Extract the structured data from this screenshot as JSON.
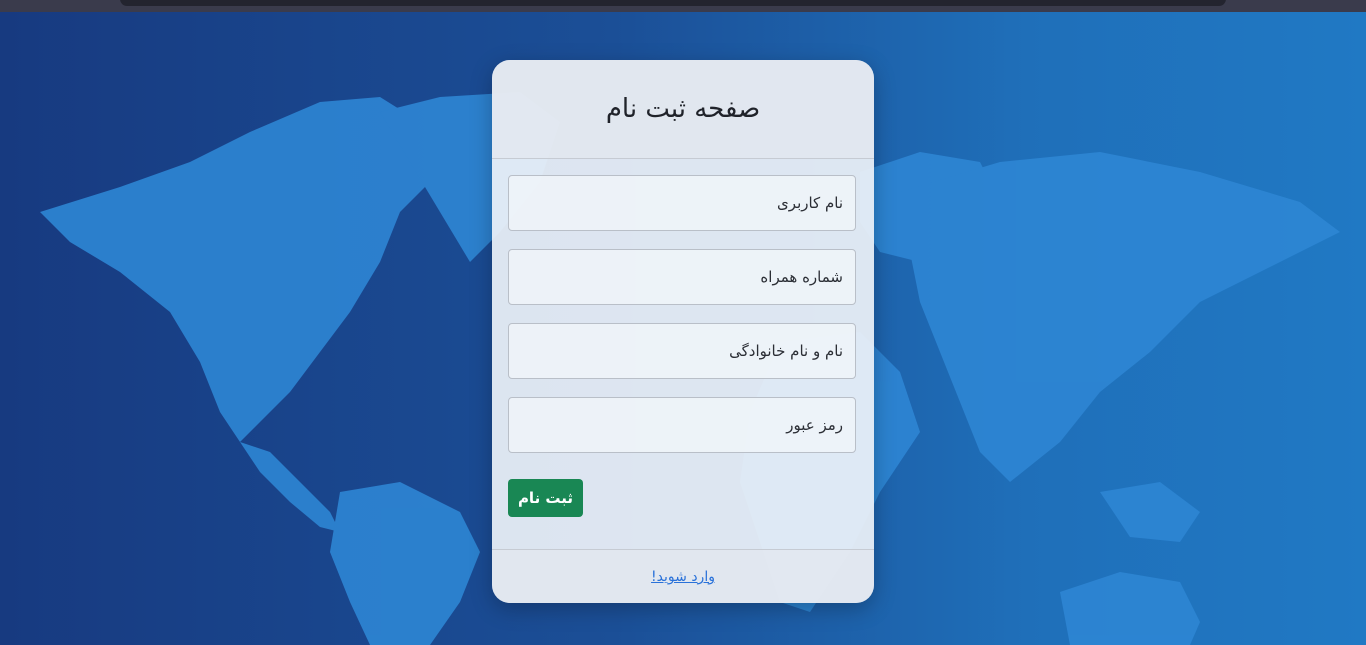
{
  "page": {
    "background_color": "#1b4f97",
    "map_color": "#2e86d4"
  },
  "card": {
    "title": "صفحه ثبت نام"
  },
  "form": {
    "username_placeholder": "نام کاربری",
    "phone_placeholder": "شماره همراه",
    "fullname_placeholder": "نام و نام خانوادگی",
    "password_placeholder": "رمز عبور",
    "submit_label": "ثبت نام",
    "submit_color": "#198754"
  },
  "footer": {
    "login_link": "وارد شوید!",
    "link_color": "#2a72d9"
  }
}
